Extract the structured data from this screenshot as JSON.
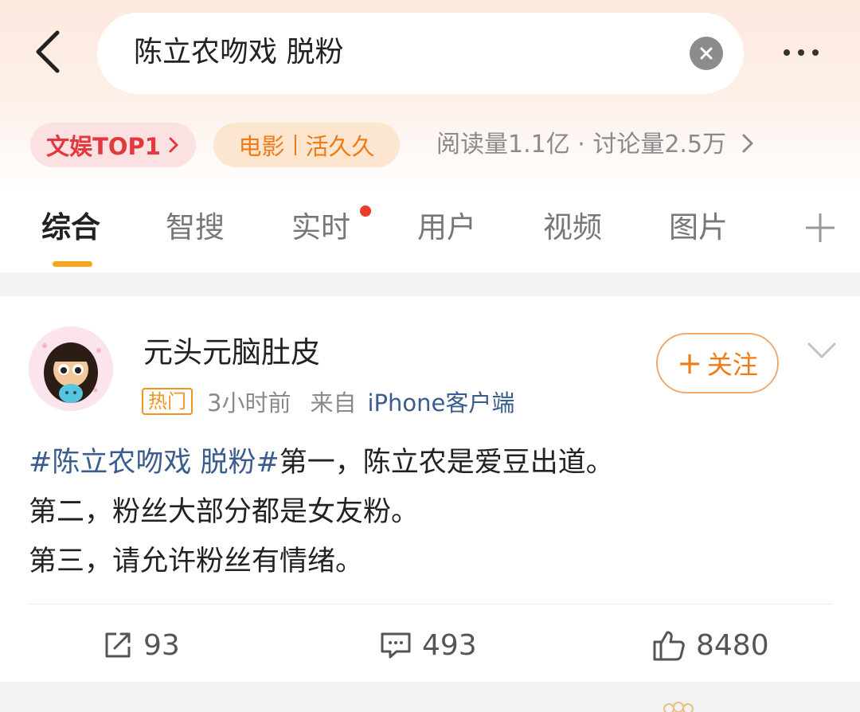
{
  "search": {
    "query": "陈立农吻戏 脱粉"
  },
  "header": {
    "back_icon": "back-arrow-icon",
    "clear_icon": "clear-circle-icon",
    "more_icon": "more-dots-icon"
  },
  "chips": {
    "rank": "文娱TOP1",
    "category_left": "电影",
    "category_right": "活久久",
    "stats": "阅读量1.1亿 · 讨论量2.5万"
  },
  "tabs": [
    {
      "label": "综合",
      "active": true
    },
    {
      "label": "智搜",
      "active": false
    },
    {
      "label": "实时",
      "active": false,
      "dot": true
    },
    {
      "label": "用户",
      "active": false
    },
    {
      "label": "视频",
      "active": false
    },
    {
      "label": "图片",
      "active": false
    }
  ],
  "post": {
    "username": "元头元脑肚皮",
    "badge": "热门",
    "time": "3小时前",
    "source_prefix": "来自",
    "device": "iPhone客户端",
    "follow_label": "关注",
    "topic": "#陈立农吻戏 脱粉#",
    "line1_rest": "第一，陈立农是爱豆出道。",
    "line2": "第二，粉丝大部分都是女友粉。",
    "line3": "第三，请允许粉丝有情绪。",
    "reposts": "93",
    "comments": "493",
    "likes": "8480"
  },
  "colors": {
    "accent_orange": "#f07b14",
    "rank_red": "#e4383f",
    "link_blue": "#3b5c8f",
    "tab_indicator": "#f8a51c"
  }
}
